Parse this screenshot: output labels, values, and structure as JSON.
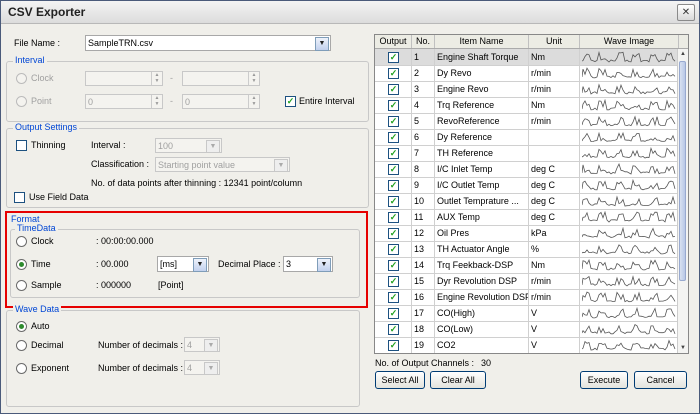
{
  "window": {
    "title": "CSV Exporter",
    "close_glyph": "✕"
  },
  "file": {
    "label": "File Name :",
    "value": "SampleTRN.csv"
  },
  "interval": {
    "group_label": "Interval",
    "clock_label": "Clock",
    "point_label": "Point",
    "point_from": "0",
    "point_to": "0",
    "dash": "-",
    "entire_label": "Entire Interval"
  },
  "output_settings": {
    "group_label": "Output Settings",
    "thinning_label": "Thinning",
    "interval_label": "Interval :",
    "interval_value": "100",
    "classification_label": "Classification :",
    "classification_value": "Starting point value",
    "points_text": "No. of data points after thinning : 12341 point/column",
    "use_field_label": "Use Field Data"
  },
  "format": {
    "group_label": "Format",
    "timedata_label": "TimeData",
    "clock_label": "Clock",
    "clock_value": ": 00:00:00.000",
    "time_label": "Time",
    "time_value": ": 00.000",
    "time_unit": "[ms]",
    "decimal_place_label": "Decimal Place :",
    "decimal_place_value": "3",
    "sample_label": "Sample",
    "sample_value": ": 000000",
    "sample_unit": "[Point]"
  },
  "wave_data": {
    "group_label": "Wave Data",
    "auto_label": "Auto",
    "decimal_label": "Decimal",
    "exponent_label": "Exponent",
    "num_decimals_label": "Number of decimals :",
    "decimal_value": "4",
    "exponent_value": "4"
  },
  "table": {
    "headers": [
      "Output",
      "No.",
      "Item Name",
      "Unit",
      "Wave Image"
    ],
    "rows": [
      {
        "no": "1",
        "name": "Engine Shaft Torque",
        "unit": "Nm"
      },
      {
        "no": "2",
        "name": "Dy Revo",
        "unit": "r/min"
      },
      {
        "no": "3",
        "name": "Engine Revo",
        "unit": "r/min"
      },
      {
        "no": "4",
        "name": "Trq Reference",
        "unit": "Nm"
      },
      {
        "no": "5",
        "name": "RevoReference",
        "unit": "r/min"
      },
      {
        "no": "6",
        "name": "Dy Reference",
        "unit": ""
      },
      {
        "no": "7",
        "name": "TH Reference",
        "unit": ""
      },
      {
        "no": "8",
        "name": "I/C Inlet Temp",
        "unit": "deg C"
      },
      {
        "no": "9",
        "name": "I/C Outlet Temp",
        "unit": "deg C"
      },
      {
        "no": "10",
        "name": "Outlet Temprature ...",
        "unit": "deg C"
      },
      {
        "no": "11",
        "name": "AUX Temp",
        "unit": "deg C"
      },
      {
        "no": "12",
        "name": "Oil Pres",
        "unit": "kPa"
      },
      {
        "no": "13",
        "name": "TH Actuator Angle",
        "unit": "%"
      },
      {
        "no": "14",
        "name": "Trq Feekback-DSP",
        "unit": "Nm"
      },
      {
        "no": "15",
        "name": "Dyr Revolution DSP",
        "unit": "r/min"
      },
      {
        "no": "16",
        "name": "Engine Revolution DSP",
        "unit": "r/min"
      },
      {
        "no": "17",
        "name": "CO(High)",
        "unit": "V"
      },
      {
        "no": "18",
        "name": "CO(Low)",
        "unit": "V"
      },
      {
        "no": "19",
        "name": "CO2",
        "unit": "V"
      }
    ]
  },
  "footer": {
    "channels_label": "No. of Output Channels :",
    "channels_value": "30",
    "select_all": "Select All",
    "clear_all": "Clear All",
    "execute": "Execute",
    "cancel": "Cancel"
  },
  "glyphs": {
    "check": "✓",
    "dropdown": "▼",
    "spin_up": "▲",
    "spin_down": "▼"
  }
}
